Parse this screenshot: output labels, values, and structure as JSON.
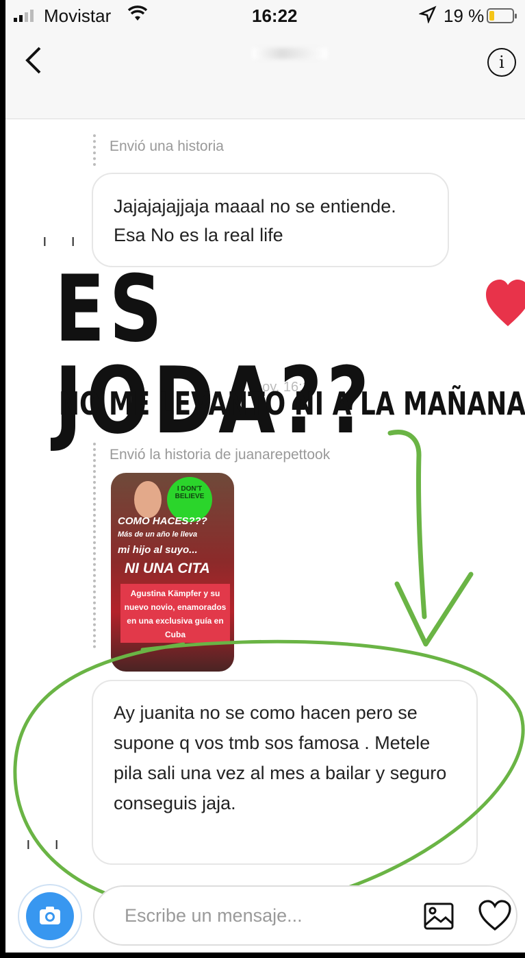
{
  "status_bar": {
    "carrier": "Movistar",
    "time": "16:22",
    "battery_percent": "19 %"
  },
  "chat": {
    "story_reply_1": {
      "meta": "Envió una historia",
      "message": "Jajajajajjaja maaal no se entiende. Esa No es la real life"
    },
    "timestamp": "hoy, 16:17",
    "story_reply_2": {
      "meta": "Envió la historia de juanarepettook",
      "story_card": {
        "badge": "I DON'T BELIEVE",
        "line1": "COMO HACES???",
        "line2": "Más de un año le lleva",
        "line3": "mi hijo al suyo...",
        "line4": "NI UNA CITA",
        "caption": "Agustina Kämpfer y su nuevo novio, enamorados en una exclusiva guía en Cuba"
      },
      "message": "Ay juanita no se como hacen pero se supone q vos tmb sos famosa . Metele pila sali una vez al mes  a bailar y seguro conseguis jaja."
    }
  },
  "overlay": {
    "headline": "ES JODA??",
    "subline": "NO ME LEVANTO NI A LA MAÑANA"
  },
  "composer": {
    "placeholder": "Escribe un mensaje..."
  },
  "colors": {
    "accent_camera": "#3897f0",
    "annotation_green": "#6ab445",
    "heart_red": "#e8334a"
  }
}
